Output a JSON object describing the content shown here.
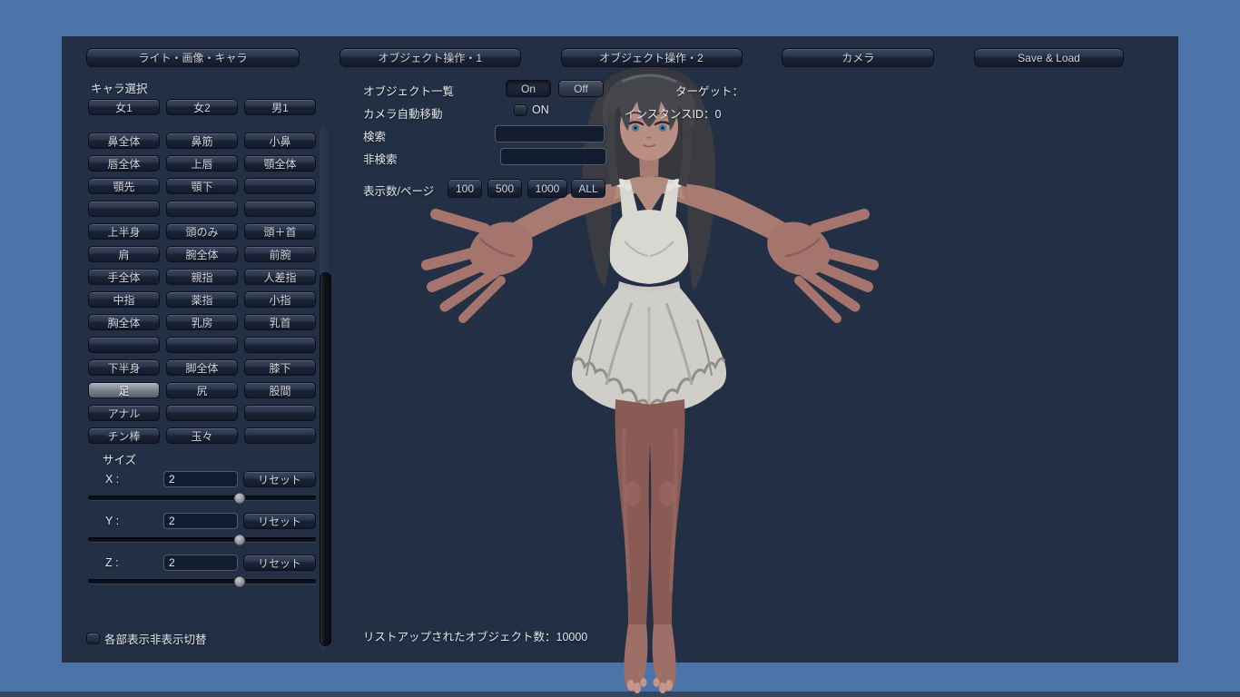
{
  "colors": {
    "desktop_bg": "#4d74a9",
    "panel_bg": "#222f44",
    "button_text": "#cfd4dc"
  },
  "tabs": [
    "ライト・画像・キャラ",
    "オブジェクト操作・1",
    "オブジェクト操作・2",
    "カメラ",
    "Save & Load"
  ],
  "character_select": {
    "label": "キャラ選択",
    "options": [
      "女1",
      "女2",
      "男1"
    ]
  },
  "body_parts": {
    "rows": [
      [
        "鼻全体",
        "鼻筋",
        "小鼻"
      ],
      [
        "唇全体",
        "上唇",
        "顎全体"
      ],
      [
        "顎先",
        "顎下",
        ""
      ],
      [
        "",
        "",
        ""
      ],
      [
        "上半身",
        "頭のみ",
        "頭＋首"
      ],
      [
        "肩",
        "腕全体",
        "前腕"
      ],
      [
        "手全体",
        "親指",
        "人差指"
      ],
      [
        "中指",
        "薬指",
        "小指"
      ],
      [
        "胸全体",
        "乳房",
        "乳首"
      ],
      [
        "",
        "",
        ""
      ],
      [
        "下半身",
        "脚全体",
        "膝下"
      ],
      [
        "足",
        "尻",
        "股間"
      ],
      [
        "アナル",
        "",
        ""
      ],
      [
        "チン棒",
        "玉々",
        ""
      ]
    ],
    "selected": "足"
  },
  "size_section": {
    "label": "サイズ",
    "reset_label": "リセット",
    "axes": [
      {
        "label": "X :",
        "value": "2",
        "slider_pct": 66.5
      },
      {
        "label": "Y :",
        "value": "2",
        "slider_pct": 66.5
      },
      {
        "label": "Z :",
        "value": "2",
        "slider_pct": 66.5
      }
    ]
  },
  "visibility_toggle": {
    "label": "各部表示非表示切替",
    "checked": false
  },
  "object_list": {
    "label": "オブジェクト一覧",
    "on_label": "On",
    "off_label": "Off",
    "camera_auto": {
      "label": "カメラ自動移動",
      "checkbox_label": "ON",
      "checked": false
    },
    "search": {
      "label": "検索",
      "value": ""
    },
    "exclude_search": {
      "label": "非検索",
      "value": ""
    },
    "per_page": {
      "label": "表示数/ページ",
      "options": [
        "100",
        "500",
        "1000",
        "ALL"
      ]
    },
    "status": "リストアップされたオブジェクト数：10000"
  },
  "target_info": {
    "target_label": "ターゲット：",
    "instance_label": "インスタンスID：0"
  }
}
